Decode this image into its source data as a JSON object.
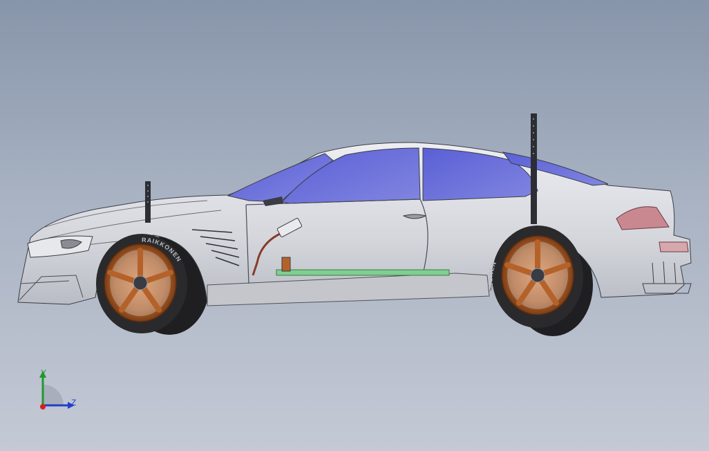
{
  "model": {
    "tire_brand": "RAIKKONEN"
  },
  "triad": {
    "y_label": "Y",
    "z_label": "Z",
    "y_color": "#1c9a2a",
    "z_color": "#1f3fc9",
    "origin_color": "#d62020"
  },
  "colors": {
    "background_top": "#8795aa",
    "background_bottom": "#c4c9d5",
    "body": "#d9dbe0",
    "glass": "#6f72d9",
    "rim": "#b4622a",
    "tire": "#2a2a2c",
    "battery": "#7fcf8e",
    "taillight": "#c98890"
  }
}
